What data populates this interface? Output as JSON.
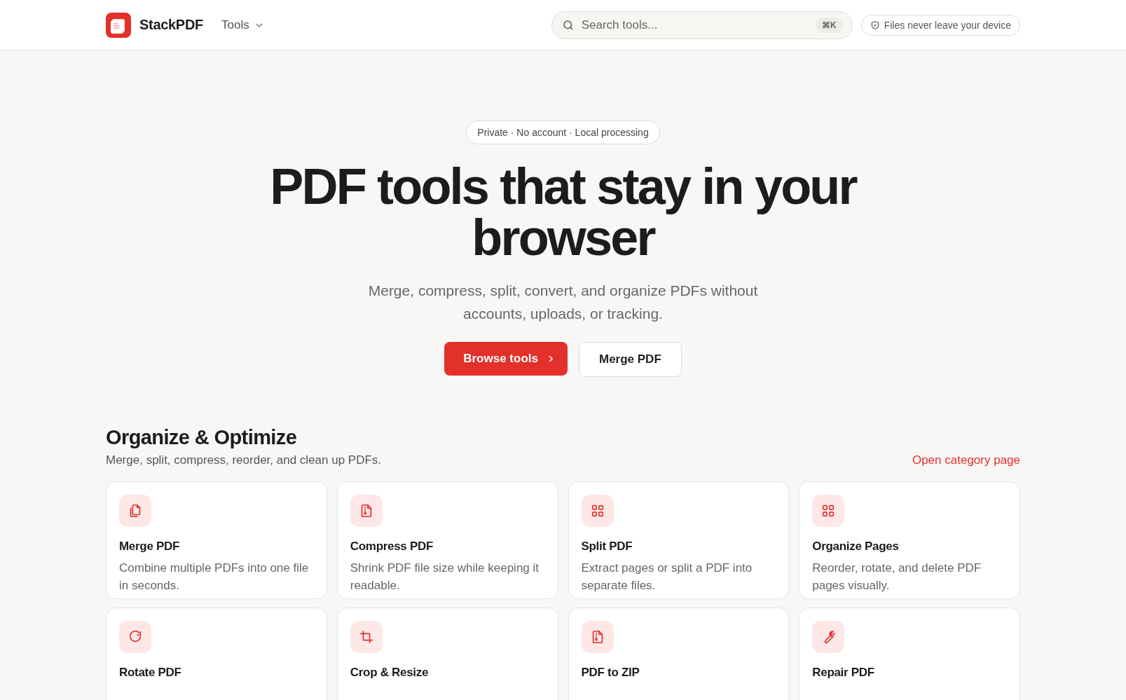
{
  "header": {
    "brand": "StackPDF",
    "nav": "Tools",
    "search": {
      "placeholder": "Search tools...",
      "shortcut": "⌘K"
    },
    "privacy_badge": "Files never leave your device"
  },
  "hero": {
    "badge": "Private · No account · Local processing",
    "title": "PDF tools that stay in your browser",
    "subtitle": "Merge, compress, split, convert, and organize PDFs without accounts, uploads, or tracking.",
    "primary_button": "Browse tools",
    "secondary_button": "Merge PDF"
  },
  "section": {
    "title": "Organize & Optimize",
    "description": "Merge, split, compress, reorder, and clean up PDFs.",
    "link": "Open category page",
    "tools": [
      {
        "name": "Merge PDF",
        "description": "Combine multiple PDFs into one file in seconds."
      },
      {
        "name": "Compress PDF",
        "description": "Shrink PDF file size while keeping it readable."
      },
      {
        "name": "Split PDF",
        "description": "Extract pages or split a PDF into separate files."
      },
      {
        "name": "Organize Pages",
        "description": "Reorder, rotate, and delete PDF pages visually."
      },
      {
        "name": "Rotate PDF"
      },
      {
        "name": "Crop & Resize"
      },
      {
        "name": "PDF to ZIP"
      },
      {
        "name": "Repair PDF"
      }
    ]
  }
}
